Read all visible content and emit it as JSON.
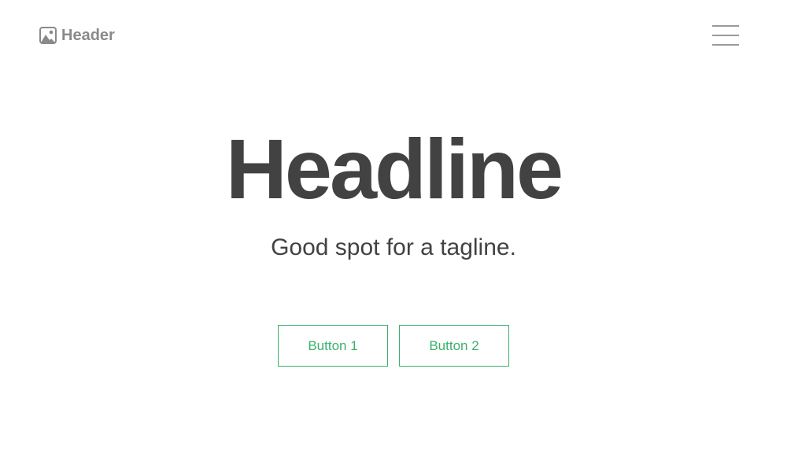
{
  "header": {
    "brand_label": "Header",
    "logo_icon": "image-icon",
    "menu_icon": "hamburger-menu-icon"
  },
  "hero": {
    "headline": "Headline",
    "tagline": "Good spot for a tagline."
  },
  "actions": {
    "button1_label": "Button 1",
    "button2_label": "Button 2"
  },
  "colors": {
    "accent": "#3ab26a",
    "text": "#424242",
    "muted": "#8a8a8a"
  }
}
